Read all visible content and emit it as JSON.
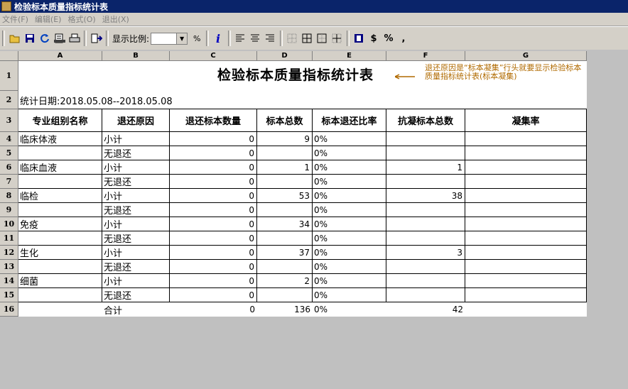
{
  "window": {
    "title": "检验标本质量指标统计表"
  },
  "menu": [
    "文件(F)",
    "编辑(E)",
    "格式(O)",
    "退出(X)"
  ],
  "toolbar": {
    "zoom_label": "显示比例:",
    "zoom_value": "",
    "pct": "%"
  },
  "columns": [
    "A",
    "B",
    "C",
    "D",
    "E",
    "F",
    "G"
  ],
  "row_numbers": [
    "1",
    "2",
    "3",
    "4",
    "5",
    "6",
    "7",
    "8",
    "9",
    "10",
    "11",
    "12",
    "13",
    "14",
    "15",
    "16"
  ],
  "report": {
    "title": "检验标本质量指标统计表",
    "note": "退还原因是“标本凝集”行头就要显示检验标本质量指标统计表(标本凝集)",
    "date_line": "统计日期:2018.05.08--2018.05.08",
    "headers": [
      "专业组别名称",
      "退还原因",
      "退还标本数量",
      "标本总数",
      "标本退还比率",
      "抗凝标本总数",
      "凝集率"
    ],
    "rows": [
      [
        "临床体液",
        "小计",
        "0",
        "9",
        "0%",
        "",
        ""
      ],
      [
        "",
        "无退还",
        "0",
        "",
        "0%",
        "",
        ""
      ],
      [
        "临床血液",
        "小计",
        "0",
        "1",
        "0%",
        "1",
        ""
      ],
      [
        "",
        "无退还",
        "0",
        "",
        "0%",
        "",
        ""
      ],
      [
        "临检",
        "小计",
        "0",
        "53",
        "0%",
        "38",
        ""
      ],
      [
        "",
        "无退还",
        "0",
        "",
        "0%",
        "",
        ""
      ],
      [
        "免疫",
        "小计",
        "0",
        "34",
        "0%",
        "",
        ""
      ],
      [
        "",
        "无退还",
        "0",
        "",
        "0%",
        "",
        ""
      ],
      [
        "生化",
        "小计",
        "0",
        "37",
        "0%",
        "3",
        ""
      ],
      [
        "",
        "无退还",
        "0",
        "",
        "0%",
        "",
        ""
      ],
      [
        "细菌",
        "小计",
        "0",
        "2",
        "0%",
        "",
        ""
      ],
      [
        "",
        "无退还",
        "0",
        "",
        "0%",
        "",
        ""
      ],
      [
        "",
        "合计",
        "0",
        "136",
        "0%",
        "42",
        ""
      ]
    ]
  }
}
